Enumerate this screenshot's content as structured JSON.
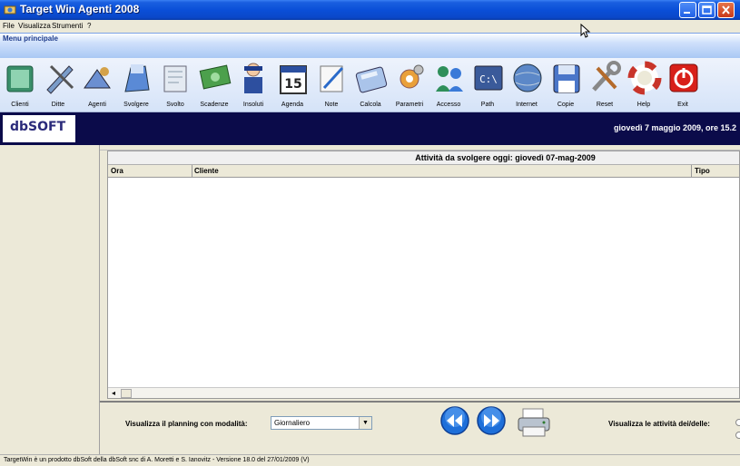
{
  "window": {
    "title": "Target Win Agenti 2008"
  },
  "menu": {
    "items": [
      "File",
      "Visualizza",
      "Strumenti",
      "?"
    ]
  },
  "section_header": "Menu principale",
  "toolbar": {
    "items": [
      {
        "label": "Clienti",
        "icon": "clients-icon"
      },
      {
        "label": "Ditte",
        "icon": "companies-icon"
      },
      {
        "label": "Agenti",
        "icon": "agents-icon"
      },
      {
        "label": "Svolgere",
        "icon": "todo-icon"
      },
      {
        "label": "Svolto",
        "icon": "done-icon"
      },
      {
        "label": "Scadenze",
        "icon": "deadlines-icon"
      },
      {
        "label": "Insoluti",
        "icon": "unpaid-icon"
      },
      {
        "label": "Agenda",
        "icon": "calendar-icon"
      },
      {
        "label": "Note",
        "icon": "notes-icon"
      },
      {
        "label": "Calcola",
        "icon": "calculator-icon"
      },
      {
        "label": "Parametri",
        "icon": "parameters-icon"
      },
      {
        "label": "Accesso",
        "icon": "access-icon"
      },
      {
        "label": "Path",
        "icon": "path-icon"
      },
      {
        "label": "Internet",
        "icon": "internet-icon"
      },
      {
        "label": "Copie",
        "icon": "backup-icon"
      },
      {
        "label": "Reset",
        "icon": "reset-icon"
      },
      {
        "label": "Help",
        "icon": "help-icon"
      },
      {
        "label": "Exit",
        "icon": "exit-icon"
      }
    ],
    "calendar_day": "15"
  },
  "header": {
    "logo": "dbSOFT",
    "datetime": "giovedì 7 maggio 2009, ore 15.2"
  },
  "grid": {
    "caption": "Attività da svolgere oggi: giovedì 07-mag-2009",
    "columns": [
      "Ora",
      "Cliente",
      "Tipo"
    ]
  },
  "bottom": {
    "mode_label": "Visualizza il planning con modalità:",
    "mode_value": "Giornaliero",
    "view_label": "Visualizza le attività dei/delle:"
  },
  "status": "TargetWin è un prodotto dbSoft della dbSoft snc di A. Moretti e S. Ianovitz  -  Versione 18.0 del 27/01/2009 (V)",
  "colors": {
    "navy": "#0b0b4a",
    "titlebar": "#0a4fd8",
    "nav_button": "#1e6fd9"
  }
}
